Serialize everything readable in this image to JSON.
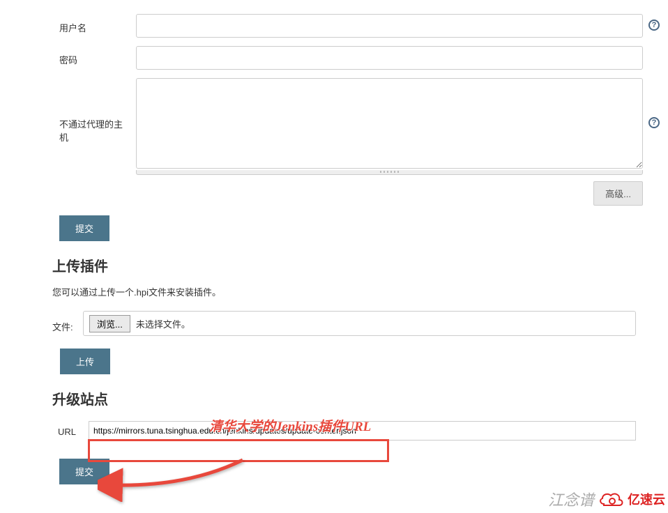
{
  "proxy": {
    "username_label": "用户名",
    "username_value": "",
    "password_label": "密码",
    "password_value": "",
    "noproxy_label": "不通过代理的主机",
    "noproxy_value": "",
    "advanced_btn": "高级...",
    "submit_btn": "提交"
  },
  "upload": {
    "title": "上传插件",
    "desc": "您可以通过上传一个.hpi文件来安装插件。",
    "file_label": "文件:",
    "browse_btn": "浏览...",
    "no_file": "未选择文件。",
    "upload_btn": "上传"
  },
  "site": {
    "title": "升级站点",
    "annotation": "清华大学的Jenkins插件URL",
    "url_label": "URL",
    "url_value": "https://mirrors.tuna.tsinghua.edu.cn/jenkins/updates/update-center.json",
    "submit_btn": "提交"
  },
  "watermark": {
    "signature": "江念谱",
    "brand": "亿速云"
  },
  "help_glyph": "?"
}
